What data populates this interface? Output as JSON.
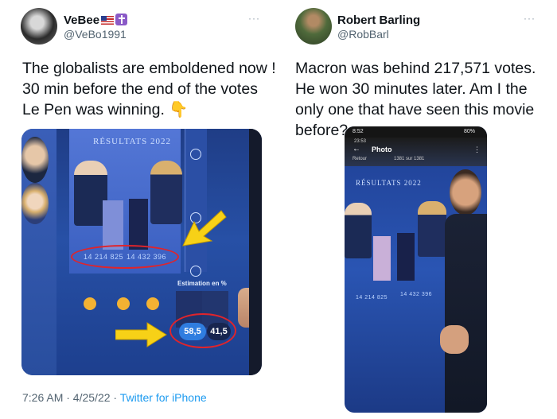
{
  "left_tweet": {
    "name": "VeBee",
    "handle": "@VeBo1991",
    "text": "The globalists are emboldened now ! 30 min before the end of the votes Le Pen was winning. 👇",
    "timestamp": "7:26 AM · 4/25/22 · ",
    "source": "Twitter for iPhone",
    "more_label": "···",
    "media": {
      "header": "RÉSULTATS 2022",
      "vote_left": "14 214 825",
      "vote_right": "14 432 396",
      "estimation_label": "Estimation en %",
      "pct_left": "58,5",
      "pct_right": "41,5"
    }
  },
  "right_tweet": {
    "name": "Robert Barling",
    "handle": "@RobBarl",
    "text": "Macron was behind 217,571 votes. He won 30 minutes later. Am I the only one that have seen this movie before?",
    "more_label": "···",
    "media": {
      "status_time": "8:52",
      "battery": "80%",
      "sub_time": "23:53",
      "photo_title": "Photo",
      "back_label": "Retour",
      "counter": "1381 sur 1381",
      "header": "RÉSULTATS 2022",
      "vote_left": "14 214 825",
      "vote_right": "14 432 396"
    }
  },
  "colors": {
    "text": "#0f1419",
    "secondary": "#536471",
    "link": "#1d9bf0",
    "highlight_red": "#e0242b",
    "arrow_yellow": "#f7d117"
  }
}
